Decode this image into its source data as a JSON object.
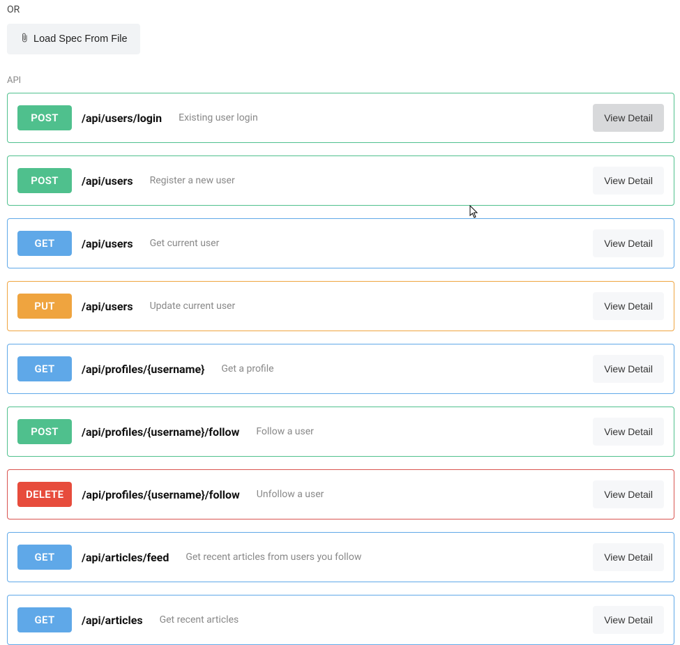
{
  "top": {
    "or_label": "OR",
    "load_spec_label": "Load Spec From File"
  },
  "section_label": "API",
  "view_detail_label": "View Detail",
  "endpoints": [
    {
      "method": "POST",
      "method_class": "post",
      "row_class": "method-post",
      "path": "/api/users/login",
      "description": "Existing user login",
      "active": true
    },
    {
      "method": "POST",
      "method_class": "post",
      "row_class": "method-post",
      "path": "/api/users",
      "description": "Register a new user",
      "active": false
    },
    {
      "method": "GET",
      "method_class": "get",
      "row_class": "method-get",
      "path": "/api/users",
      "description": "Get current user",
      "active": false
    },
    {
      "method": "PUT",
      "method_class": "put",
      "row_class": "method-put",
      "path": "/api/users",
      "description": "Update current user",
      "active": false
    },
    {
      "method": "GET",
      "method_class": "get",
      "row_class": "method-get",
      "path": "/api/profiles/{username}",
      "description": "Get a profile",
      "active": false
    },
    {
      "method": "POST",
      "method_class": "post",
      "row_class": "method-post",
      "path": "/api/profiles/{username}/follow",
      "description": "Follow a user",
      "active": false
    },
    {
      "method": "DELETE",
      "method_class": "delete",
      "row_class": "method-delete",
      "path": "/api/profiles/{username}/follow",
      "description": "Unfollow a user",
      "active": false
    },
    {
      "method": "GET",
      "method_class": "get",
      "row_class": "method-get",
      "path": "/api/articles/feed",
      "description": "Get recent articles from users you follow",
      "active": false
    },
    {
      "method": "GET",
      "method_class": "get",
      "row_class": "method-get",
      "path": "/api/articles",
      "description": "Get recent articles",
      "active": false
    }
  ]
}
